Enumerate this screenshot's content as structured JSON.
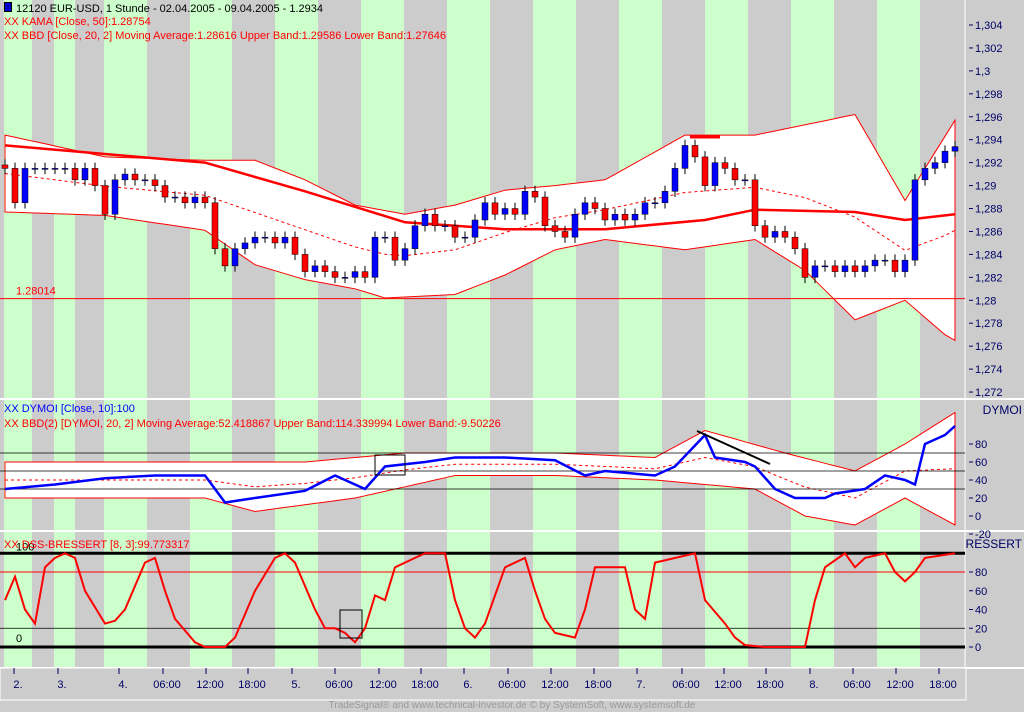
{
  "header": {
    "title": "12120  EUR-USD, 1 Stunde - 02.04.2005 - 09.04.2005 - 1.2934"
  },
  "legends": {
    "kama": "XX KAMA [Close, 50]:1.28754",
    "bbd": "XX BBD [Close, 20, 2] Moving Average:1.28616 Upper Band:1.29586 Lower Band:1.27646",
    "dymoi": "XX DYMOI [Close, 10]:100",
    "bbd2": "XX BBD(2) [DYMOI, 20, 2] Moving Average:52.418867 Upper Band:114.339994 Lower Band:-9.50226",
    "dss": "XX DSS-BRESSERT [8, 3]:99.773317"
  },
  "panel_titles": {
    "dymoi": "DYMOI",
    "dss": "BRESSERT"
  },
  "footer": "TradeSignal® and www.technical-investor.de © by SystemSoft, www.systemsoft.de",
  "colors": {
    "green": "#ccffcc",
    "gray": "#cccccc",
    "red": "#ff0000",
    "blue": "#0000ff"
  },
  "chart_data": [
    {
      "type": "candlestick",
      "name": "EUR-USD 1h",
      "ylim": [
        1.271,
        1.305
      ],
      "yticks": [
        "1,304",
        "1,302",
        "1,3",
        "1,298",
        "1,296",
        "1,294",
        "1,292",
        "1,29",
        "1,288",
        "1,286",
        "1,284",
        "1,282",
        "1,28",
        "1,278",
        "1,276",
        "1,274",
        "1,272"
      ],
      "close": [
        1.2915,
        1.2885,
        1.2915,
        1.2915,
        1.2915,
        1.2915,
        1.2915,
        1.2905,
        1.2915,
        1.29,
        1.2875,
        1.2905,
        1.291,
        1.2905,
        1.2905,
        1.29,
        1.289,
        1.289,
        1.2885,
        1.289,
        1.2885,
        1.2845,
        1.283,
        1.2845,
        1.285,
        1.2855,
        1.2855,
        1.285,
        1.2855,
        1.284,
        1.2825,
        1.283,
        1.2825,
        1.282,
        1.282,
        1.2825,
        1.282,
        1.2855,
        1.2855,
        1.2835,
        1.2845,
        1.2865,
        1.2875,
        1.2865,
        1.2865,
        1.2855,
        1.2855,
        1.287,
        1.2885,
        1.2875,
        1.288,
        1.2875,
        1.2895,
        1.289,
        1.2865,
        1.286,
        1.2855,
        1.2875,
        1.2885,
        1.288,
        1.287,
        1.2875,
        1.287,
        1.2875,
        1.2885,
        1.2885,
        1.2895,
        1.2915,
        1.2935,
        1.2925,
        1.29,
        1.292,
        1.2915,
        1.2905,
        1.2905,
        1.2865,
        1.2855,
        1.286,
        1.2855,
        1.2845,
        1.282,
        1.283,
        1.283,
        1.2825,
        1.283,
        1.2825,
        1.283,
        1.2835,
        1.2835,
        1.2825,
        1.2835,
        1.2905,
        1.2915,
        1.292,
        1.293,
        1.2934
      ],
      "kama": [
        [
          0,
          1.2935
        ],
        [
          20,
          1.292
        ],
        [
          30,
          1.2895
        ],
        [
          40,
          1.2868
        ],
        [
          50,
          1.2862
        ],
        [
          60,
          1.2862
        ],
        [
          70,
          1.287
        ],
        [
          75,
          1.2879
        ],
        [
          85,
          1.2877
        ],
        [
          90,
          1.287
        ],
        [
          95,
          1.2875
        ]
      ],
      "bb_upper": [
        [
          0,
          1.2944
        ],
        [
          10,
          1.2925
        ],
        [
          20,
          1.2922
        ],
        [
          25,
          1.2922
        ],
        [
          30,
          1.2905
        ],
        [
          35,
          1.2883
        ],
        [
          40,
          1.2875
        ],
        [
          45,
          1.2883
        ],
        [
          50,
          1.2896
        ],
        [
          55,
          1.29
        ],
        [
          60,
          1.2905
        ],
        [
          68,
          1.2944
        ],
        [
          75,
          1.2944
        ],
        [
          80,
          1.2953
        ],
        [
          85,
          1.2962
        ],
        [
          90,
          1.2887
        ],
        [
          95,
          1.2957
        ]
      ],
      "bb_lower": [
        [
          0,
          1.2877
        ],
        [
          10,
          1.2874
        ],
        [
          20,
          1.2861
        ],
        [
          25,
          1.2831
        ],
        [
          30,
          1.2818
        ],
        [
          35,
          1.281
        ],
        [
          38,
          1.2802
        ],
        [
          45,
          1.2805
        ],
        [
          50,
          1.2822
        ],
        [
          55,
          1.2844
        ],
        [
          60,
          1.2853
        ],
        [
          68,
          1.2844
        ],
        [
          75,
          1.2853
        ],
        [
          80,
          1.2826
        ],
        [
          85,
          1.2783
        ],
        [
          90,
          1.28
        ],
        [
          94,
          1.277
        ],
        [
          95,
          1.2765
        ]
      ],
      "hline": {
        "value": 1.28014,
        "label": "1.28014"
      }
    },
    {
      "type": "line",
      "name": "DYMOI",
      "ylim": [
        -30,
        105
      ],
      "yticks": [
        "80",
        "60",
        "40",
        "20",
        "0",
        "-20"
      ],
      "levels": [
        70,
        50,
        30
      ],
      "values": [
        [
          0,
          30
        ],
        [
          5,
          35
        ],
        [
          10,
          42
        ],
        [
          15,
          45
        ],
        [
          20,
          45
        ],
        [
          22,
          15
        ],
        [
          25,
          20
        ],
        [
          30,
          28
        ],
        [
          33,
          45
        ],
        [
          36,
          30
        ],
        [
          38,
          55
        ],
        [
          42,
          60
        ],
        [
          45,
          65
        ],
        [
          50,
          65
        ],
        [
          55,
          62
        ],
        [
          58,
          45
        ],
        [
          60,
          50
        ],
        [
          65,
          45
        ],
        [
          67,
          55
        ],
        [
          70,
          90
        ],
        [
          71,
          65
        ],
        [
          74,
          60
        ],
        [
          75,
          55
        ],
        [
          77,
          30
        ],
        [
          79,
          20
        ],
        [
          82,
          20
        ],
        [
          83,
          25
        ],
        [
          86,
          30
        ],
        [
          88,
          45
        ],
        [
          90,
          40
        ],
        [
          91,
          35
        ],
        [
          92,
          80
        ],
        [
          94,
          90
        ],
        [
          95,
          100
        ]
      ],
      "bb_upper": [
        [
          0,
          60
        ],
        [
          20,
          60
        ],
        [
          30,
          60
        ],
        [
          40,
          70
        ],
        [
          55,
          70
        ],
        [
          65,
          65
        ],
        [
          70,
          95
        ],
        [
          78,
          70
        ],
        [
          85,
          50
        ],
        [
          90,
          80
        ],
        [
          95,
          115
        ]
      ],
      "bb_lower": [
        [
          0,
          20
        ],
        [
          20,
          20
        ],
        [
          25,
          5
        ],
        [
          35,
          20
        ],
        [
          45,
          45
        ],
        [
          55,
          45
        ],
        [
          65,
          40
        ],
        [
          75,
          30
        ],
        [
          80,
          0
        ],
        [
          85,
          -10
        ],
        [
          90,
          20
        ],
        [
          95,
          -10
        ]
      ]
    },
    {
      "type": "line",
      "name": "DSS-BRESSERT",
      "ylim": [
        -5,
        105
      ],
      "yticks": [
        "80",
        "60",
        "40",
        "20",
        "0"
      ],
      "levels": [
        100,
        80,
        20,
        0
      ],
      "level_labels": [
        "100",
        "0"
      ],
      "values": [
        [
          0,
          50
        ],
        [
          1,
          75
        ],
        [
          2,
          40
        ],
        [
          3,
          25
        ],
        [
          4,
          85
        ],
        [
          5,
          95
        ],
        [
          6,
          100
        ],
        [
          7,
          95
        ],
        [
          8,
          60
        ],
        [
          10,
          25
        ],
        [
          11,
          28
        ],
        [
          12,
          40
        ],
        [
          14,
          90
        ],
        [
          15,
          95
        ],
        [
          16,
          60
        ],
        [
          17,
          30
        ],
        [
          19,
          5
        ],
        [
          20,
          0
        ],
        [
          22,
          0
        ],
        [
          23,
          10
        ],
        [
          25,
          60
        ],
        [
          27,
          95
        ],
        [
          28,
          100
        ],
        [
          29,
          90
        ],
        [
          31,
          40
        ],
        [
          32,
          20
        ],
        [
          33,
          20
        ],
        [
          34,
          15
        ],
        [
          35,
          5
        ],
        [
          36,
          20
        ],
        [
          37,
          55
        ],
        [
          38,
          50
        ],
        [
          39,
          85
        ],
        [
          41,
          95
        ],
        [
          42,
          100
        ],
        [
          44,
          100
        ],
        [
          45,
          50
        ],
        [
          46,
          20
        ],
        [
          47,
          10
        ],
        [
          48,
          25
        ],
        [
          50,
          85
        ],
        [
          52,
          95
        ],
        [
          53,
          60
        ],
        [
          54,
          30
        ],
        [
          55,
          15
        ],
        [
          57,
          10
        ],
        [
          58,
          40
        ],
        [
          59,
          85
        ],
        [
          62,
          85
        ],
        [
          63,
          40
        ],
        [
          64,
          30
        ],
        [
          65,
          90
        ],
        [
          69,
          100
        ],
        [
          70,
          50
        ],
        [
          72,
          25
        ],
        [
          73,
          10
        ],
        [
          74,
          2
        ],
        [
          76,
          0
        ],
        [
          80,
          0
        ],
        [
          81,
          50
        ],
        [
          82,
          85
        ],
        [
          84,
          100
        ],
        [
          85,
          85
        ],
        [
          86,
          95
        ],
        [
          88,
          100
        ],
        [
          89,
          80
        ],
        [
          90,
          70
        ],
        [
          91,
          80
        ],
        [
          92,
          95
        ],
        [
          95,
          100
        ]
      ]
    }
  ],
  "x_axis": [
    "2.",
    "3.",
    "4.",
    "06:00",
    "12:00",
    "18:00",
    "5.",
    "06:00",
    "12:00",
    "18:00",
    "6.",
    "06:00",
    "12:00",
    "18:00",
    "7.",
    "06:00",
    "12:00",
    "18:00",
    "8.",
    "06:00",
    "12:00",
    "18:00"
  ]
}
